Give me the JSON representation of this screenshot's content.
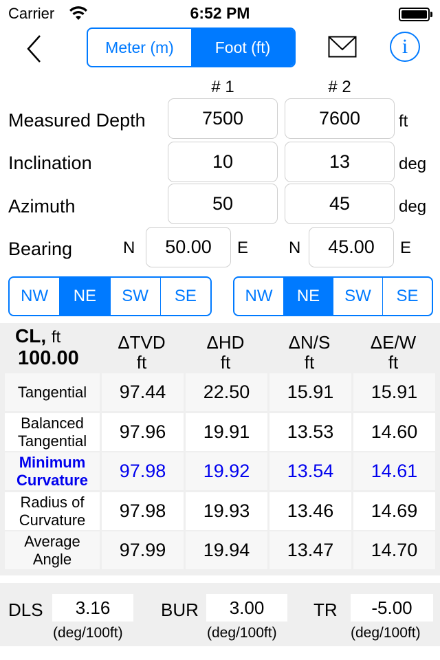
{
  "status_bar": {
    "carrier": "Carrier",
    "time": "6:52 PM"
  },
  "nav": {
    "units": [
      {
        "label": "Meter (m)",
        "active": false
      },
      {
        "label": "Foot (ft)",
        "active": true
      }
    ],
    "back_icon": "chevron-left-icon",
    "mail_icon": "envelope-icon",
    "info_icon": "info-circle-icon",
    "info_glyph": "i"
  },
  "inputs": {
    "col1_header": "# 1",
    "col2_header": "# 2",
    "measured_depth": {
      "label": "Measured Depth",
      "v1": "7500",
      "v2": "7600",
      "unit": "ft"
    },
    "inclination": {
      "label": "Inclination",
      "v1": "10",
      "v2": "13",
      "unit": "deg"
    },
    "azimuth": {
      "label": "Azimuth",
      "v1": "50",
      "v2": "45",
      "unit": "deg"
    },
    "bearing": {
      "label": "Bearing",
      "b1": {
        "prefix": "N",
        "value": "50.00",
        "suffix": "E"
      },
      "b2": {
        "prefix": "N",
        "value": "45.00",
        "suffix": "E"
      }
    },
    "quadrants1": [
      {
        "label": "NW"
      },
      {
        "label": "NE",
        "active": true
      },
      {
        "label": "SW"
      },
      {
        "label": "SE"
      }
    ],
    "quadrants2": [
      {
        "label": "NW"
      },
      {
        "label": "NE",
        "active": true
      },
      {
        "label": "SW"
      },
      {
        "label": "SE"
      }
    ]
  },
  "results": {
    "cl_label": "CL,",
    "cl_unit": "ft",
    "cl_value": "100.00",
    "headers": [
      {
        "name": "ΔTVD",
        "unit": "ft"
      },
      {
        "name": "ΔHD",
        "unit": "ft"
      },
      {
        "name": "ΔN/S",
        "unit": "ft"
      },
      {
        "name": "ΔE/W",
        "unit": "ft"
      }
    ],
    "rows": [
      {
        "method": "Tangential",
        "values": [
          "97.44",
          "22.50",
          "15.91",
          "15.91"
        ],
        "highlight": false
      },
      {
        "method": "Balanced Tangential",
        "values": [
          "97.96",
          "19.91",
          "13.53",
          "14.60"
        ],
        "highlight": false
      },
      {
        "method": "Minimum Curvature",
        "values": [
          "97.98",
          "19.92",
          "13.54",
          "14.61"
        ],
        "highlight": true
      },
      {
        "method": "Radius of Curvature",
        "values": [
          "97.98",
          "19.93",
          "13.46",
          "14.69"
        ],
        "highlight": false
      },
      {
        "method": "Average Angle",
        "values": [
          "97.99",
          "19.94",
          "13.47",
          "14.70"
        ],
        "highlight": false
      }
    ],
    "highlight_color": "#0000ee"
  },
  "rates": {
    "dls": {
      "label": "DLS",
      "value": "3.16",
      "unit": "(deg/100ft)"
    },
    "bur": {
      "label": "BUR",
      "value": "3.00",
      "unit": "(deg/100ft)"
    },
    "tr": {
      "label": "TR",
      "value": "-5.00",
      "unit": "(deg/100ft)"
    }
  },
  "colors": {
    "accent": "#007aff",
    "panel_bg": "#efefef"
  }
}
